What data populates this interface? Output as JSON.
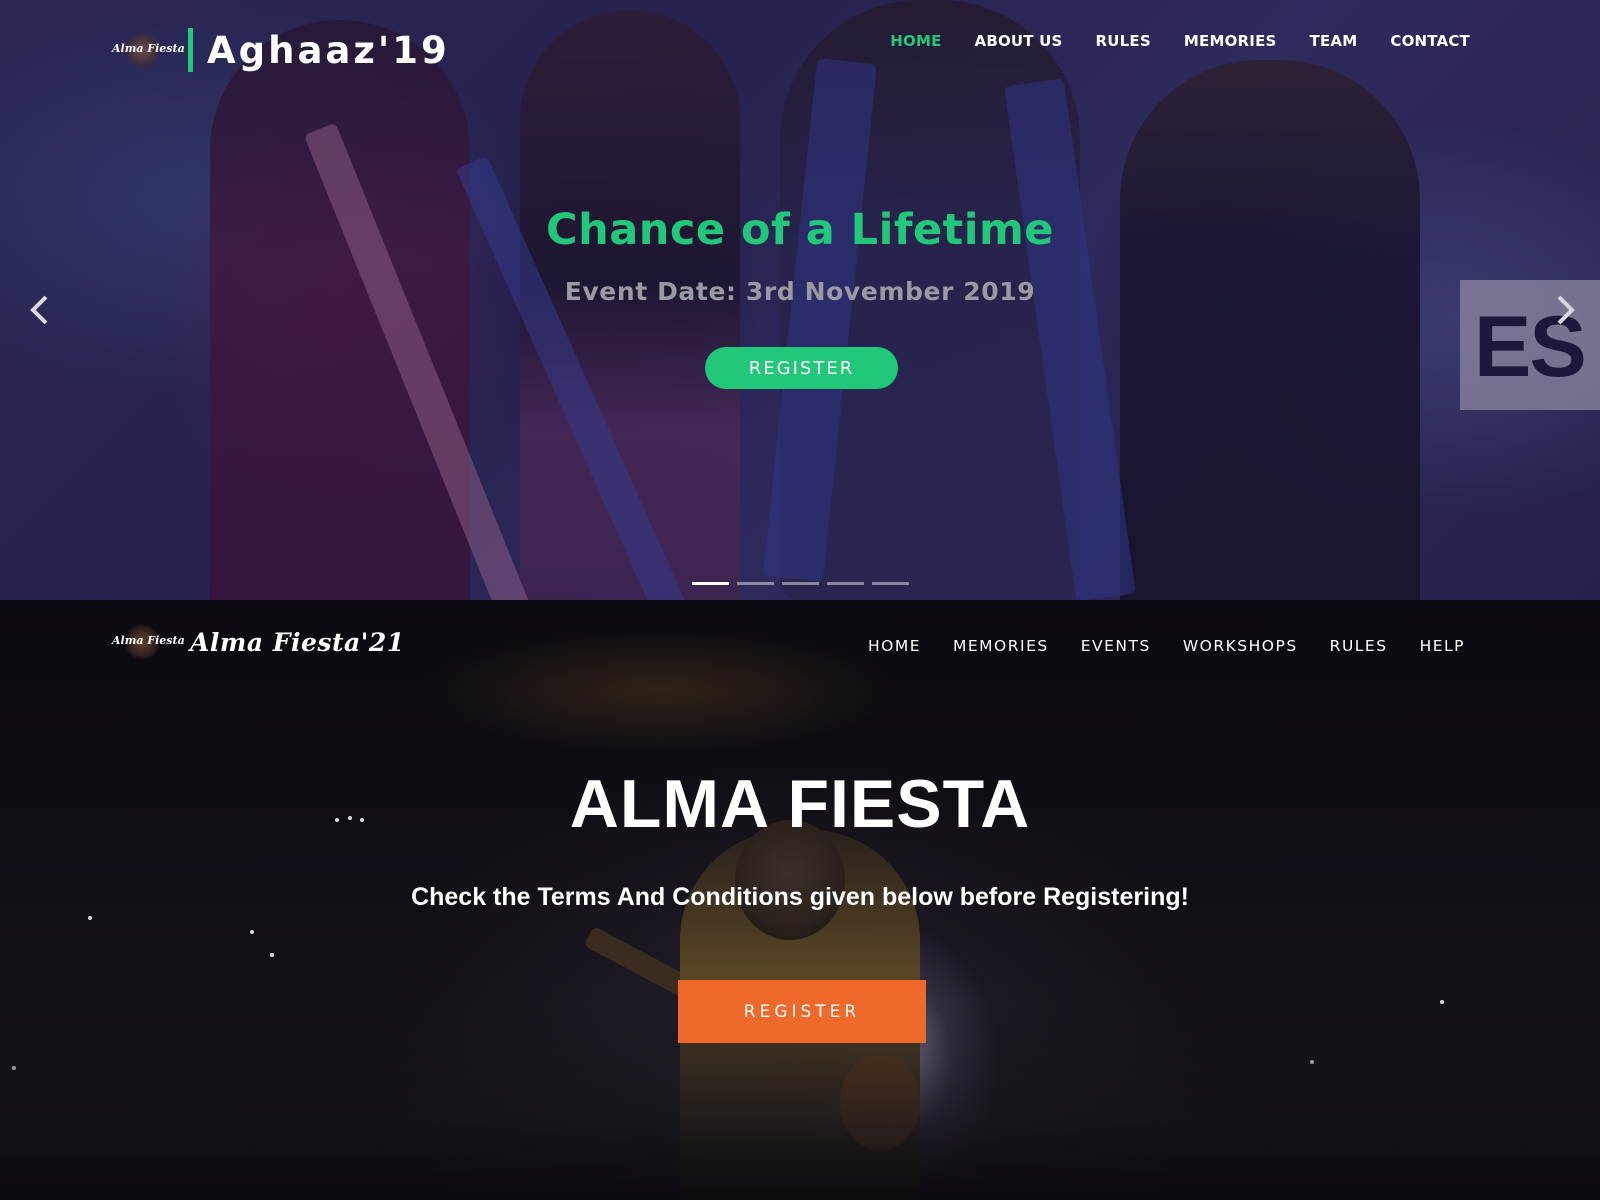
{
  "top": {
    "logo_text": "Alma Fiesta",
    "brand_title": "Aghaaz'19",
    "nav": [
      "HOME",
      "ABOUT US",
      "RULES",
      "MEMORIES",
      "TEAM",
      "CONTACT"
    ],
    "active_nav": "HOME",
    "slide": {
      "title": "Chance of a Lifetime",
      "subtitle": "Event Date: 3rd November 2019",
      "button": "REGISTER"
    },
    "background_text": "ES",
    "carousel_indicators": 5,
    "active_indicator": 1,
    "accent_color": "#22c87a"
  },
  "bottom": {
    "logo_text": "Alma Fiesta",
    "brand_title": "Alma Fiesta'21",
    "nav": [
      "HOME",
      "MEMORIES",
      "EVENTS",
      "WORKSHOPS",
      "RULES",
      "HELP"
    ],
    "title": "ALMA FIESTA",
    "subtitle": "Check the Terms And Conditions given below before Registering!",
    "button": "REGISTER",
    "accent_color": "#ef6a2a"
  }
}
